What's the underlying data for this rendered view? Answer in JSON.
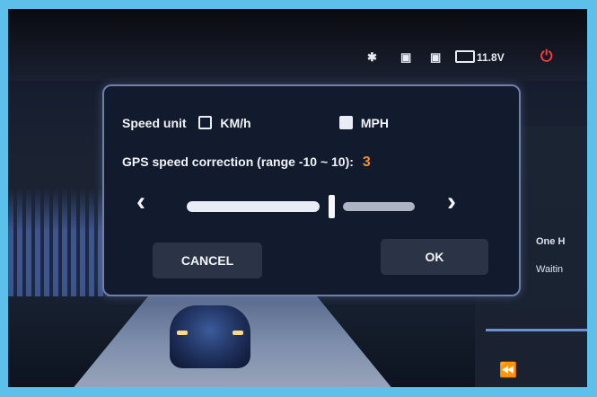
{
  "status_bar": {
    "bluetooth_icon": "bluetooth-icon",
    "battery_voltage": "11.8V",
    "power_icon_color": "#ff3a3a"
  },
  "dialog": {
    "speed_unit_label": "Speed unit",
    "options": [
      {
        "label": "KM/h",
        "checked": false
      },
      {
        "label": "MPH",
        "checked": true
      }
    ],
    "gps_label": "GPS speed correction (range -10 ~ 10):",
    "gps_value": "3",
    "value_color": "#ff8a26",
    "prev_arrow": "‹",
    "next_arrow": "›",
    "slider_level_fraction": 0.65,
    "cancel_label": "CANCEL",
    "ok_label": "OK"
  },
  "background": {
    "right_title": "One H",
    "right_subtitle": "Waitin"
  }
}
